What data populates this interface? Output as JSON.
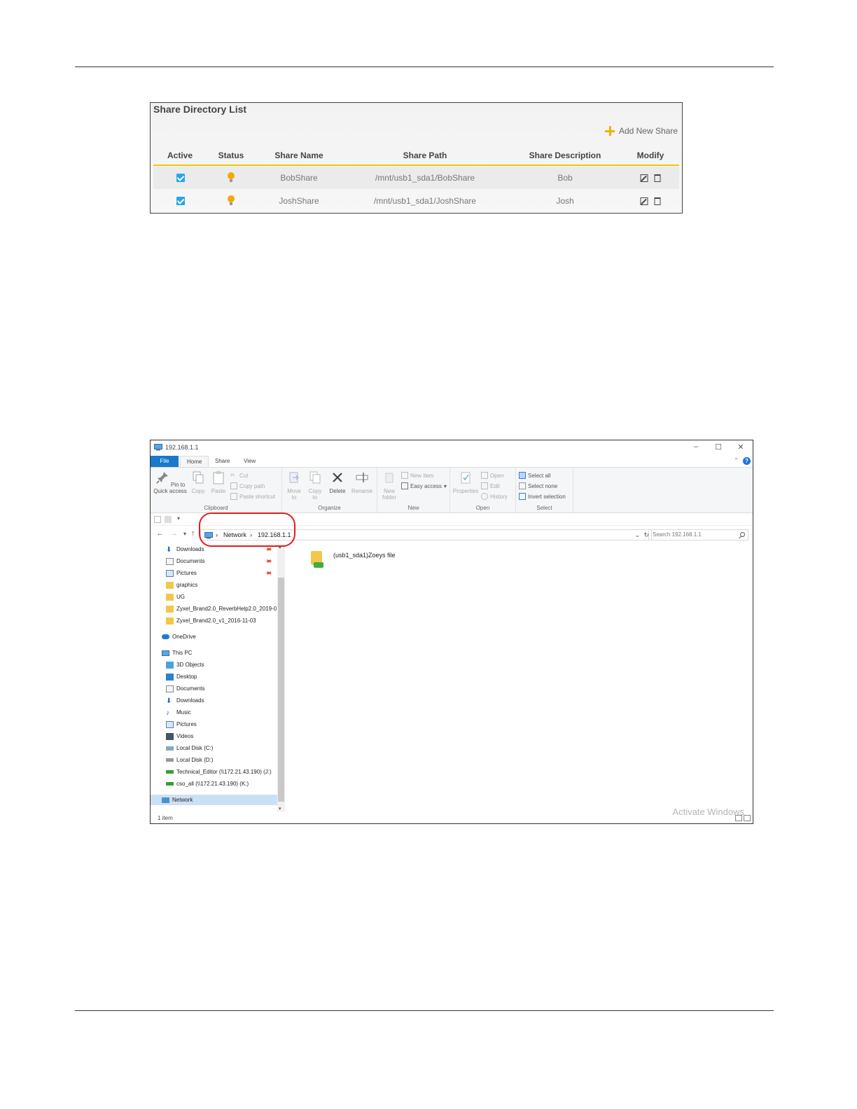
{
  "share_directory": {
    "title": "Share Directory List",
    "add_label": "Add New Share",
    "columns": [
      "Active",
      "Status",
      "Share Name",
      "Share Path",
      "Share Description",
      "Modify"
    ],
    "rows": [
      {
        "active": true,
        "name": "BobShare",
        "path": "/mnt/usb1_sda1/BobShare",
        "description": "Bob"
      },
      {
        "active": true,
        "name": "JoshShare",
        "path": "/mnt/usb1_sda1/JoshShare",
        "description": "Josh"
      }
    ],
    "accent_color": "#f0c800",
    "checkbox_color": "#27a7e8"
  },
  "explorer": {
    "title": "192.168.1.1",
    "tabs": [
      "File",
      "Home",
      "Share",
      "View"
    ],
    "ribbon": {
      "clipboard": {
        "label": "Clipboard",
        "pin": "Pin to Quick access",
        "copy": "Copy",
        "paste": "Paste",
        "cut": "Cut",
        "copy_path": "Copy path",
        "paste_shortcut": "Paste shortcut"
      },
      "organize": {
        "label": "Organize",
        "move_to": "Move to",
        "copy_to": "Copy to",
        "delete": "Delete",
        "rename": "Rename"
      },
      "new": {
        "label": "New",
        "new_folder": "New folder",
        "new_item": "New item",
        "easy_access": "Easy access"
      },
      "open": {
        "label": "Open",
        "properties": "Properties",
        "open": "Open",
        "edit": "Edit",
        "history": "History"
      },
      "select": {
        "label": "Select",
        "select_all": "Select all",
        "select_none": "Select none",
        "invert": "Invert selection"
      }
    },
    "address": {
      "network": "Network",
      "host": "192.168.1.1"
    },
    "search_placeholder": "Search 192.168.1.1",
    "nav_quick": [
      "Downloads",
      "Documents",
      "Pictures",
      "graphics",
      "UG",
      "Zyxel_Brand2.0_ReverbHelp2.0_2019-0",
      "Zyxel_Brand2.0_v1_2016-11-03"
    ],
    "nav_onedrive": "OneDrive",
    "nav_thispc": "This PC",
    "nav_pc_items": [
      "3D Objects",
      "Desktop",
      "Documents",
      "Downloads",
      "Music",
      "Pictures",
      "Videos",
      "Local Disk (C:)",
      "Local Disk (D:)",
      "Technical_Editor (\\\\172.21.43.190) (J:)",
      "cso_all (\\\\172.21.43.190) (K:)"
    ],
    "nav_network": "Network",
    "content_items": [
      "(usb1_sda1)Zoeys file"
    ],
    "status": "1 item",
    "watermark": "Activate Windows",
    "file_tab_color": "#1979ca",
    "highlight_color": "#e21b1b"
  }
}
